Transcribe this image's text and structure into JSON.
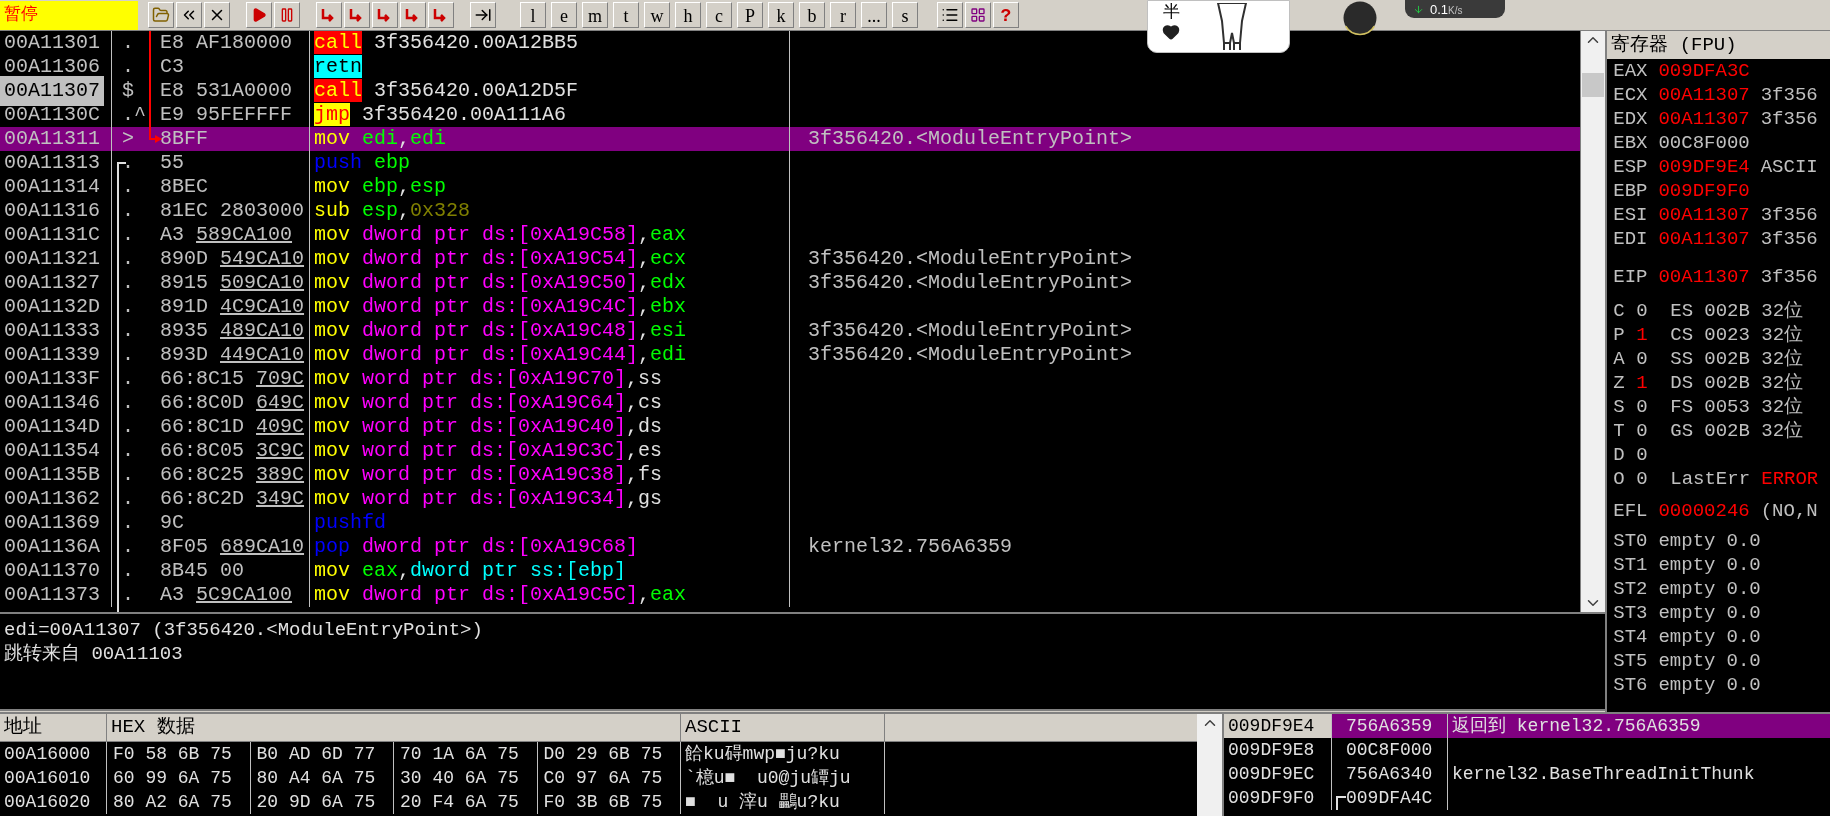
{
  "toolbar": {
    "status": "暂停",
    "letter_buttons": [
      "l",
      "e",
      "m",
      "t",
      "w",
      "h",
      "c",
      "P",
      "k",
      "b",
      "r",
      "...",
      "s"
    ],
    "help": "?"
  },
  "overlay": {
    "sticker_text": "半",
    "speed": "0.1",
    "unit": "K/s"
  },
  "disassembly": {
    "rows": [
      {
        "address": "00A11301",
        "marked": false,
        "selected": false,
        "marker": ".",
        "hex": "E8 AF180000",
        "code": [
          {
            "text": "call",
            "kind": "op_call"
          },
          {
            "text": " 3f356420.00A12BB5",
            "kind": "text"
          }
        ]
      },
      {
        "address": "00A11306",
        "marked": false,
        "selected": false,
        "marker": ".",
        "hex": "C3",
        "code": [
          {
            "text": "retn",
            "kind": "op_ret"
          }
        ]
      },
      {
        "address": "00A11307",
        "marked": true,
        "selected": false,
        "marker": "$",
        "hex": "E8 531A0000",
        "code": [
          {
            "text": "call",
            "kind": "op_call"
          },
          {
            "text": " 3f356420.00A12D5F",
            "kind": "text"
          }
        ]
      },
      {
        "address": "00A1130C",
        "marked": false,
        "selected": false,
        "marker": ".^",
        "hex": "E9 95FEFFFF",
        "code": [
          {
            "text": "jmp",
            "kind": "op_jmp"
          },
          {
            "text": " 3f356420.00A111A6",
            "kind": "text"
          }
        ]
      },
      {
        "address": "00A11311",
        "marked": false,
        "selected": true,
        "marker": ">",
        "hex": "8BFF",
        "code": [
          {
            "text": "mov ",
            "kind": "op_mov"
          },
          {
            "text": "edi",
            "kind": "reg"
          },
          {
            "text": ",",
            "kind": "text"
          },
          {
            "text": "edi",
            "kind": "reg"
          }
        ],
        "comment": "3f356420.<ModuleEntryPoint>"
      },
      {
        "address": "00A11313",
        "marked": false,
        "selected": false,
        "marker": ".",
        "hex": "55",
        "code": [
          {
            "text": "push ",
            "kind": "op_stack"
          },
          {
            "text": "ebp",
            "kind": "reg"
          }
        ]
      },
      {
        "address": "00A11314",
        "marked": false,
        "selected": false,
        "marker": ".",
        "hex": "8BEC",
        "code": [
          {
            "text": "mov ",
            "kind": "op_mov"
          },
          {
            "text": "ebp",
            "kind": "reg"
          },
          {
            "text": ",",
            "kind": "text"
          },
          {
            "text": "esp",
            "kind": "reg"
          }
        ]
      },
      {
        "address": "00A11316",
        "marked": false,
        "selected": false,
        "marker": ".",
        "hex": "81EC 2803000",
        "code": [
          {
            "text": "sub ",
            "kind": "op_mov"
          },
          {
            "text": "esp",
            "kind": "reg"
          },
          {
            "text": ",",
            "kind": "text"
          },
          {
            "text": "0x328",
            "kind": "imm"
          }
        ]
      },
      {
        "address": "00A1131C",
        "marked": false,
        "selected": false,
        "marker": ".",
        "hex": "A3 ",
        "ref": "589CA100",
        "code": [
          {
            "text": "mov ",
            "kind": "op_mov"
          },
          {
            "text": "dword ptr ds:[0xA19C58]",
            "kind": "mem"
          },
          {
            "text": ",",
            "kind": "text"
          },
          {
            "text": "eax",
            "kind": "reg"
          }
        ]
      },
      {
        "address": "00A11321",
        "marked": false,
        "selected": false,
        "marker": ".",
        "hex": "890D ",
        "ref": "549CA10",
        "code": [
          {
            "text": "mov ",
            "kind": "op_mov"
          },
          {
            "text": "dword ptr ds:[0xA19C54]",
            "kind": "mem"
          },
          {
            "text": ",",
            "kind": "text"
          },
          {
            "text": "ecx",
            "kind": "reg"
          }
        ],
        "comment": "3f356420.<ModuleEntryPoint>"
      },
      {
        "address": "00A11327",
        "marked": false,
        "selected": false,
        "marker": ".",
        "hex": "8915 ",
        "ref": "509CA10",
        "code": [
          {
            "text": "mov ",
            "kind": "op_mov"
          },
          {
            "text": "dword ptr ds:[0xA19C50]",
            "kind": "mem"
          },
          {
            "text": ",",
            "kind": "text"
          },
          {
            "text": "edx",
            "kind": "reg"
          }
        ],
        "comment": "3f356420.<ModuleEntryPoint>"
      },
      {
        "address": "00A1132D",
        "marked": false,
        "selected": false,
        "marker": ".",
        "hex": "891D ",
        "ref": "4C9CA10",
        "code": [
          {
            "text": "mov ",
            "kind": "op_mov"
          },
          {
            "text": "dword ptr ds:[0xA19C4C]",
            "kind": "mem"
          },
          {
            "text": ",",
            "kind": "text"
          },
          {
            "text": "ebx",
            "kind": "reg"
          }
        ]
      },
      {
        "address": "00A11333",
        "marked": false,
        "selected": false,
        "marker": ".",
        "hex": "8935 ",
        "ref": "489CA10",
        "code": [
          {
            "text": "mov ",
            "kind": "op_mov"
          },
          {
            "text": "dword ptr ds:[0xA19C48]",
            "kind": "mem"
          },
          {
            "text": ",",
            "kind": "text"
          },
          {
            "text": "esi",
            "kind": "reg"
          }
        ],
        "comment": "3f356420.<ModuleEntryPoint>"
      },
      {
        "address": "00A11339",
        "marked": false,
        "selected": false,
        "marker": ".",
        "hex": "893D ",
        "ref": "449CA10",
        "code": [
          {
            "text": "mov ",
            "kind": "op_mov"
          },
          {
            "text": "dword ptr ds:[0xA19C44]",
            "kind": "mem"
          },
          {
            "text": ",",
            "kind": "text"
          },
          {
            "text": "edi",
            "kind": "reg"
          }
        ],
        "comment": "3f356420.<ModuleEntryPoint>"
      },
      {
        "address": "00A1133F",
        "marked": false,
        "selected": false,
        "marker": ".",
        "hex": "66:8C15 ",
        "ref": "709C",
        "code": [
          {
            "text": "mov ",
            "kind": "op_mov"
          },
          {
            "text": "word ptr ds:[0xA19C70]",
            "kind": "mem"
          },
          {
            "text": ",ss",
            "kind": "text"
          }
        ]
      },
      {
        "address": "00A11346",
        "marked": false,
        "selected": false,
        "marker": ".",
        "hex": "66:8C0D ",
        "ref": "649C",
        "code": [
          {
            "text": "mov ",
            "kind": "op_mov"
          },
          {
            "text": "word ptr ds:[0xA19C64]",
            "kind": "mem"
          },
          {
            "text": ",cs",
            "kind": "text"
          }
        ]
      },
      {
        "address": "00A1134D",
        "marked": false,
        "selected": false,
        "marker": ".",
        "hex": "66:8C1D ",
        "ref": "409C",
        "code": [
          {
            "text": "mov ",
            "kind": "op_mov"
          },
          {
            "text": "word ptr ds:[0xA19C40]",
            "kind": "mem"
          },
          {
            "text": ",ds",
            "kind": "text"
          }
        ]
      },
      {
        "address": "00A11354",
        "marked": false,
        "selected": false,
        "marker": ".",
        "hex": "66:8C05 ",
        "ref": "3C9C",
        "code": [
          {
            "text": "mov ",
            "kind": "op_mov"
          },
          {
            "text": "word ptr ds:[0xA19C3C]",
            "kind": "mem"
          },
          {
            "text": ",es",
            "kind": "text"
          }
        ]
      },
      {
        "address": "00A1135B",
        "marked": false,
        "selected": false,
        "marker": ".",
        "hex": "66:8C25 ",
        "ref": "389C",
        "code": [
          {
            "text": "mov ",
            "kind": "op_mov"
          },
          {
            "text": "word ptr ds:[0xA19C38]",
            "kind": "mem"
          },
          {
            "text": ",fs",
            "kind": "text"
          }
        ]
      },
      {
        "address": "00A11362",
        "marked": false,
        "selected": false,
        "marker": ".",
        "hex": "66:8C2D ",
        "ref": "349C",
        "code": [
          {
            "text": "mov ",
            "kind": "op_mov"
          },
          {
            "text": "word ptr ds:[0xA19C34]",
            "kind": "mem"
          },
          {
            "text": ",gs",
            "kind": "text"
          }
        ]
      },
      {
        "address": "00A11369",
        "marked": false,
        "selected": false,
        "marker": ".",
        "hex": "9C",
        "code": [
          {
            "text": "pushfd",
            "kind": "op_stack"
          }
        ]
      },
      {
        "address": "00A1136A",
        "marked": false,
        "selected": false,
        "marker": ".",
        "hex": "8F05 ",
        "ref": "689CA10",
        "code": [
          {
            "text": "pop ",
            "kind": "op_stack"
          },
          {
            "text": "dword ptr ds:[0xA19C68]",
            "kind": "mem"
          }
        ],
        "comment": "kernel32.756A6359"
      },
      {
        "address": "00A11370",
        "marked": false,
        "selected": false,
        "marker": ".",
        "hex": "8B45 00",
        "code": [
          {
            "text": "mov ",
            "kind": "op_mov"
          },
          {
            "text": "eax",
            "kind": "reg"
          },
          {
            "text": ",",
            "kind": "text"
          },
          {
            "text": "dword ptr ss:[ebp]",
            "kind": "smem"
          }
        ]
      },
      {
        "address": "00A11373",
        "marked": false,
        "selected": false,
        "marker": ".",
        "hex": "A3 ",
        "ref": "5C9CA100",
        "code": [
          {
            "text": "mov ",
            "kind": "op_mov"
          },
          {
            "text": "dword ptr ds:[0xA19C5C]",
            "kind": "mem"
          },
          {
            "text": ",",
            "kind": "text"
          },
          {
            "text": "eax",
            "kind": "reg"
          }
        ]
      }
    ]
  },
  "registers": {
    "title": "寄存器 (FPU)",
    "general": [
      {
        "name": "EAX",
        "value": "009DFA3C",
        "changed": true
      },
      {
        "name": "ECX",
        "value": "00A11307",
        "changed": true,
        "comment": "3f356"
      },
      {
        "name": "EDX",
        "value": "00A11307",
        "changed": true,
        "comment": "3f356"
      },
      {
        "name": "EBX",
        "value": "00C8F000",
        "changed": false
      },
      {
        "name": "ESP",
        "value": "009DF9E4",
        "changed": true,
        "comment": "ASCII"
      },
      {
        "name": "EBP",
        "value": "009DF9F0",
        "changed": true
      },
      {
        "name": "ESI",
        "value": "00A11307",
        "changed": true,
        "comment": "3f356"
      },
      {
        "name": "EDI",
        "value": "00A11307",
        "changed": true,
        "comment": "3f356"
      }
    ],
    "eip": {
      "name": "EIP",
      "value": "00A11307",
      "changed": true,
      "comment": "3f356"
    },
    "flags": [
      {
        "kind": "segment",
        "flag": "C",
        "value": "0",
        "changed": false,
        "seg": "ES",
        "seg_value": "002B",
        "bits": "32位"
      },
      {
        "kind": "segment",
        "flag": "P",
        "value": "1",
        "changed": true,
        "seg": "CS",
        "seg_value": "0023",
        "bits": "32位"
      },
      {
        "kind": "segment",
        "flag": "A",
        "value": "0",
        "changed": false,
        "seg": "SS",
        "seg_value": "002B",
        "bits": "32位"
      },
      {
        "kind": "segment",
        "flag": "Z",
        "value": "1",
        "changed": true,
        "seg": "DS",
        "seg_value": "002B",
        "bits": "32位"
      },
      {
        "kind": "segment",
        "flag": "S",
        "value": "0",
        "changed": false,
        "seg": "FS",
        "seg_value": "0053",
        "bits": "32位"
      },
      {
        "kind": "segment",
        "flag": "T",
        "value": "0",
        "changed": false,
        "seg": "GS",
        "seg_value": "002B",
        "bits": "32位"
      },
      {
        "kind": "plain",
        "flag": "D",
        "value": "0",
        "changed": false
      },
      {
        "kind": "lasterr",
        "flag": "O",
        "value": "0",
        "changed": false,
        "label": "LastErr",
        "error": "ERROR"
      }
    ],
    "efl": {
      "name": "EFL",
      "value": "00000246",
      "changed": true,
      "comment": "(NO,N"
    },
    "fpu": [
      {
        "name": "ST0",
        "tag": "empty",
        "value": "0.0"
      },
      {
        "name": "ST1",
        "tag": "empty",
        "value": "0.0"
      },
      {
        "name": "ST2",
        "tag": "empty",
        "value": "0.0"
      },
      {
        "name": "ST3",
        "tag": "empty",
        "value": "0.0"
      },
      {
        "name": "ST4",
        "tag": "empty",
        "value": "0.0"
      },
      {
        "name": "ST5",
        "tag": "empty",
        "value": "0.0"
      },
      {
        "name": "ST6",
        "tag": "empty",
        "value": "0.0"
      }
    ]
  },
  "info": [
    "edi=00A11307 (3f356420.<ModuleEntryPoint>)",
    "跳转来自 00A11103"
  ],
  "dump": {
    "columns": [
      "地址",
      "HEX 数据",
      "ASCII"
    ],
    "rows": [
      {
        "address": "00A16000",
        "groups": [
          "F0 58 6B 75",
          "B0 AD 6D 77",
          "70 1A 6A 75",
          "D0 29 6B 75"
        ],
        "ascii": "餄ku碍mwp■ju?ku"
      },
      {
        "address": "00A16010",
        "groups": [
          "60 99 6A 75",
          "80 A4 6A 75",
          "30 40 6A 75",
          "C0 97 6A 75"
        ],
        "ascii": "`檍u■  u0@ju罈ju"
      },
      {
        "address": "00A16020",
        "groups": [
          "80 A2 6A 75",
          "20 9D 6A 75",
          "20 F4 6A 75",
          "F0 3B 6B 75"
        ],
        "ascii": "■  u 滓u 鸓u?ku"
      }
    ]
  },
  "stack": {
    "rows": [
      {
        "address": "009DF9E4",
        "value": "756A6359",
        "comment": "返回到 kernel32.756A6359",
        "selected": true,
        "bracket": false
      },
      {
        "address": "009DF9E8",
        "value": "00C8F000",
        "selected": false,
        "bracket": false
      },
      {
        "address": "009DF9EC",
        "value": "756A6340",
        "comment": "kernel32.BaseThreadInitThunk",
        "selected": false,
        "bracket": false
      },
      {
        "address": "009DF9F0",
        "value": "009DFA4C",
        "selected": false,
        "bracket": true
      }
    ]
  }
}
